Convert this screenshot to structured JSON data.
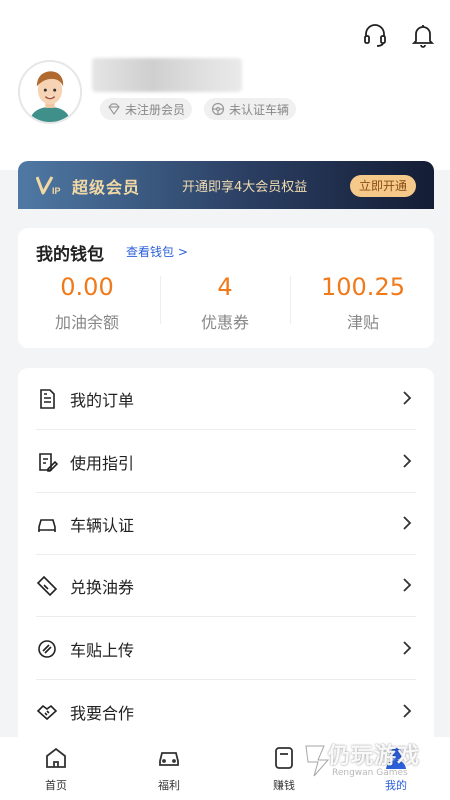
{
  "header": {
    "icons": [
      "headset-icon",
      "bell-icon"
    ],
    "badges": [
      {
        "icon": "diamond-icon",
        "label": "未注册会员"
      },
      {
        "icon": "steering-wheel-icon",
        "label": "未认证车辆"
      }
    ]
  },
  "vip": {
    "title": "超级会员",
    "promo": "开通即享4大会员权益",
    "button": "立即开通"
  },
  "wallet": {
    "title": "我的钱包",
    "link": "查看钱包 >",
    "stats": [
      {
        "value": "0.00",
        "label": "加油余额"
      },
      {
        "value": "4",
        "label": "优惠券"
      },
      {
        "value": "100.25",
        "label": "津贴"
      }
    ]
  },
  "menu": [
    {
      "icon": "order-icon",
      "label": "我的订单"
    },
    {
      "icon": "guide-icon",
      "label": "使用指引"
    },
    {
      "icon": "car-icon",
      "label": "车辆认证"
    },
    {
      "icon": "coupon-icon",
      "label": "兑换油券"
    },
    {
      "icon": "sticker-icon",
      "label": "车贴上传"
    },
    {
      "icon": "handshake-icon",
      "label": "我要合作"
    }
  ],
  "tabbar": [
    {
      "icon": "home-icon",
      "label": "首页"
    },
    {
      "icon": "car-icon",
      "label": "福利"
    },
    {
      "icon": "earn-icon",
      "label": "赚钱"
    },
    {
      "icon": "user-icon",
      "label": "我的"
    }
  ],
  "watermark": {
    "text": "仍玩游戏",
    "sub": "Rengwan Games"
  },
  "colors": {
    "accent": "#2b5fd9",
    "value_orange": "#f07a1a",
    "vip_gold": "#f2d9a4"
  }
}
